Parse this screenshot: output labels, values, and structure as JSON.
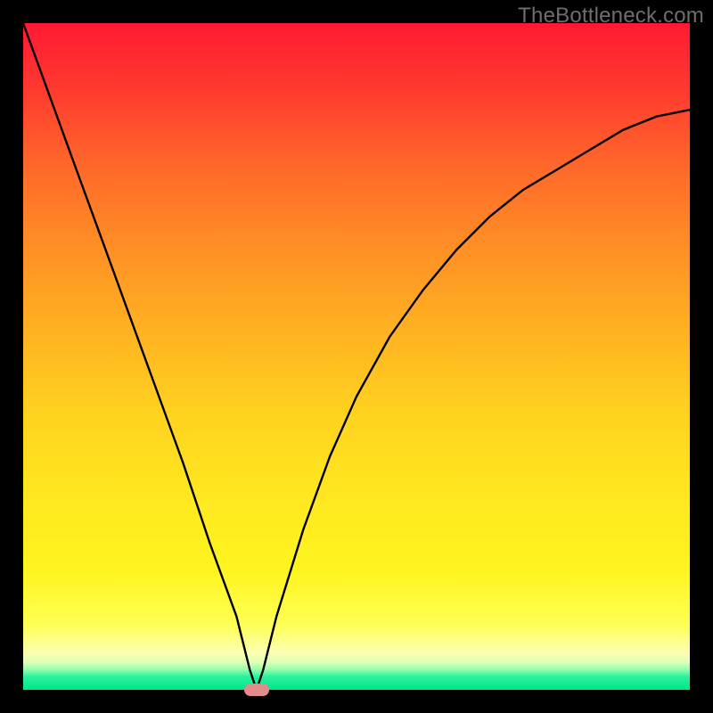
{
  "watermark": "TheBottleneck.com",
  "chart_data": {
    "type": "line",
    "title": "",
    "xlabel": "",
    "ylabel": "",
    "xlim": [
      0,
      100
    ],
    "ylim": [
      0,
      100
    ],
    "grid": false,
    "legend": false,
    "series": [
      {
        "name": "bottleneck-curve",
        "x": [
          0,
          4,
          8,
          12,
          16,
          20,
          24,
          28,
          32,
          34,
          35,
          36,
          38,
          42,
          46,
          50,
          55,
          60,
          65,
          70,
          75,
          80,
          85,
          90,
          95,
          100
        ],
        "values": [
          100,
          89,
          78,
          67,
          56,
          45,
          34,
          22,
          11,
          3,
          0,
          3,
          11,
          24,
          35,
          44,
          53,
          60,
          66,
          71,
          75,
          78,
          81,
          84,
          86,
          87
        ]
      }
    ],
    "minimum": {
      "x": 35,
      "y": 0
    },
    "gradient_stops": [
      {
        "pos": 0,
        "color": "#ff1a33"
      },
      {
        "pos": 0.5,
        "color": "#ffd11f"
      },
      {
        "pos": 0.95,
        "color": "#fbffb4"
      },
      {
        "pos": 1.0,
        "color": "#00e68a"
      }
    ]
  }
}
